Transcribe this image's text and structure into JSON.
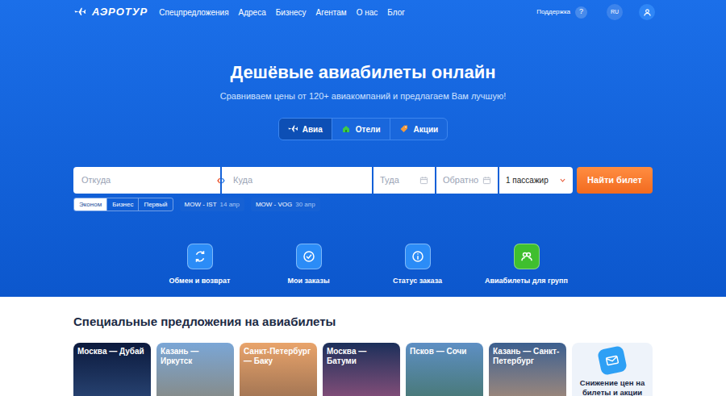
{
  "logo": {
    "text": "АЭРОТУР"
  },
  "nav": [
    {
      "label": "Спецпредложения"
    },
    {
      "label": "Адреса"
    },
    {
      "label": "Бизнесу"
    },
    {
      "label": "Агентам"
    },
    {
      "label": "О нас"
    },
    {
      "label": "Блог"
    }
  ],
  "header_right": {
    "support": "Поддержка",
    "help": "?",
    "language": "RU"
  },
  "hero": {
    "title": "Дешёвые авиабилеты онлайн",
    "subtitle": "Сравниваем цены от 120+ авиакомпаний и предлагаем Вам лучшую!"
  },
  "product_tabs": [
    {
      "label": "Авиа",
      "selected": true
    },
    {
      "label": "Отели",
      "selected": false
    },
    {
      "label": "Акции",
      "selected": false
    }
  ],
  "search": {
    "from_placeholder": "Откуда",
    "to_placeholder": "Куда",
    "depart_placeholder": "Туда",
    "return_placeholder": "Обратно",
    "passengers": "1 пассажир",
    "button": "Найти билет"
  },
  "cabin_classes": [
    {
      "label": "Эконом",
      "selected": true
    },
    {
      "label": "Бизнес",
      "selected": false
    },
    {
      "label": "Первый",
      "selected": false
    }
  ],
  "recent_searches": [
    {
      "route": "MOW - IST",
      "date": "14 апр"
    },
    {
      "route": "MOW - VOG",
      "date": "30 апр"
    }
  ],
  "quick_actions": [
    {
      "label": "Обмен и возврат",
      "color": "#2b8cf7"
    },
    {
      "label": "Мои заказы",
      "color": "#2b8cf7"
    },
    {
      "label": "Статус заказа",
      "color": "#2b8cf7"
    },
    {
      "label": "Авиабилеты для групп",
      "color": "#3fbf2e"
    }
  ],
  "offers": {
    "title": "Специальные предложения на авиабилеты",
    "cards": [
      {
        "route": "Москва — Дубай"
      },
      {
        "route": "Казань — Иркутск"
      },
      {
        "route": "Санкт-Петербург — Баку"
      },
      {
        "route": "Москва — Батуми"
      },
      {
        "route": "Псков — Сочи"
      },
      {
        "route": "Казань — Санкт-Петербург"
      }
    ],
    "promo": {
      "text": "Снижение цен на билеты и акции"
    }
  }
}
